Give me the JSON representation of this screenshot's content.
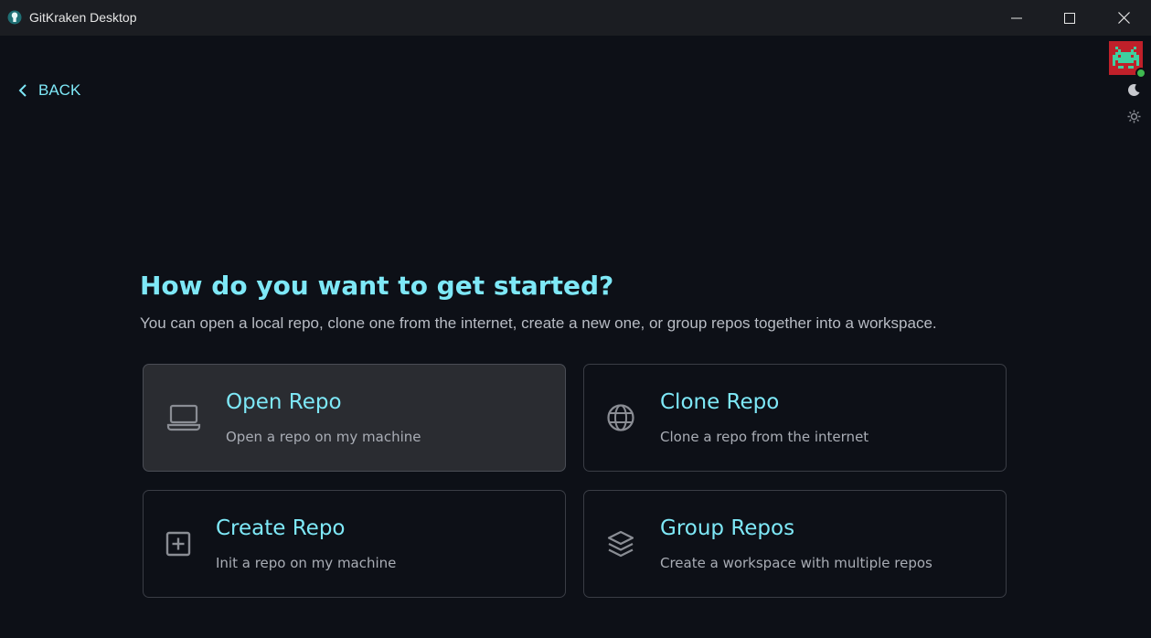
{
  "window": {
    "title": "GitKraken Desktop",
    "controls": {
      "minimize": "minimize-icon",
      "maximize": "maximize-icon",
      "close": "close-icon"
    }
  },
  "nav": {
    "back_label": "BACK"
  },
  "header": {
    "title": "How do you want to get started?",
    "subtitle": "You can open a local repo, clone one from the internet, create a new one, or group repos together into a workspace."
  },
  "options": [
    {
      "title": "Open Repo",
      "description": "Open a repo on my machine",
      "icon": "laptop-icon",
      "selected": true
    },
    {
      "title": "Clone Repo",
      "description": "Clone a repo from the internet",
      "icon": "globe-icon",
      "selected": false
    },
    {
      "title": "Create Repo",
      "description": "Init a repo on my machine",
      "icon": "plus-square-icon",
      "selected": false
    },
    {
      "title": "Group Repos",
      "description": "Create a workspace with multiple repos",
      "icon": "layers-icon",
      "selected": false
    }
  ],
  "colors": {
    "accent": "#7ee8f7",
    "background": "#0d1017",
    "titlebar": "#1b1d22",
    "online": "#3fb950",
    "avatar": "#c0202a"
  }
}
